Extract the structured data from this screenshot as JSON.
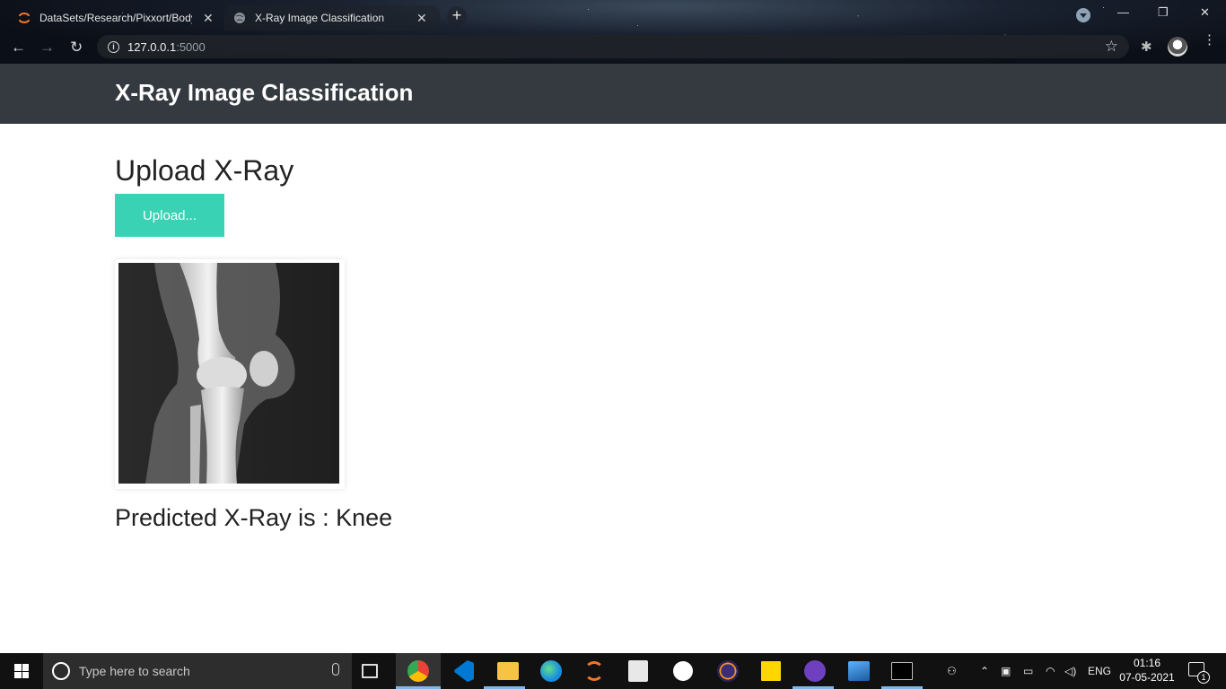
{
  "browser": {
    "tabs": [
      {
        "title": "DataSets/Research/Pixxort/Body",
        "close": "✕"
      },
      {
        "title": "X-Ray Image Classification",
        "close": "✕"
      }
    ],
    "new_tab": "+",
    "url_host": "127.0.0.1",
    "url_port": ":5000",
    "window_controls": {
      "minimize": "—",
      "restore": "❐",
      "close": "✕"
    },
    "nav": {
      "back": "←",
      "forward": "→",
      "reload": "↻"
    },
    "bookmark_star": "☆",
    "extensions": "✱",
    "menu": "⋮",
    "info": "i"
  },
  "page": {
    "brand": "X-Ray Image Classification",
    "heading": "Upload X-Ray",
    "upload_button": "Upload...",
    "result_text": "Predicted X-Ray is : Knee"
  },
  "taskbar": {
    "search_placeholder": "Type here to search",
    "apps": [
      "task-view-icon",
      "chrome-icon",
      "vscode-icon",
      "file-explorer-icon",
      "edge-icon",
      "jupyter-icon",
      "sheets-icon",
      "mongodb-icon",
      "eclipse-icon",
      "sticky-notes-icon",
      "github-icon",
      "photos-icon",
      "terminal-icon"
    ],
    "language": "ENG",
    "time": "01:16",
    "date": "07-05-2021",
    "notifications": "1"
  },
  "colors": {
    "navbar": "#343a40",
    "upload_button": "#39d2b4",
    "taskbar": "#111111"
  }
}
